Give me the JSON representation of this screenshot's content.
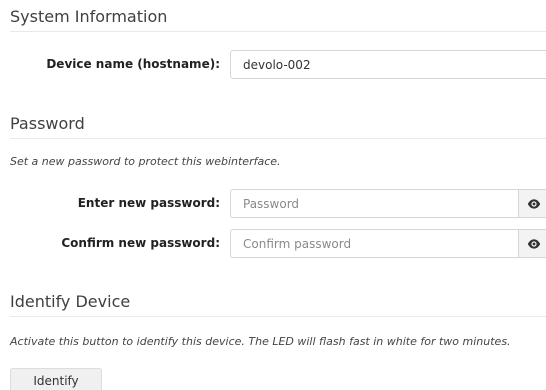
{
  "system": {
    "title": "System Information",
    "hostname_label": "Device name (hostname):",
    "hostname_value": "devolo-002"
  },
  "password": {
    "title": "Password",
    "description": "Set a new password to protect this webinterface.",
    "new_label": "Enter new password:",
    "new_placeholder": "Password",
    "confirm_label": "Confirm new password:",
    "confirm_placeholder": "Confirm password",
    "toggle_icon": "eye-icon"
  },
  "identify": {
    "title": "Identify Device",
    "description": "Activate this button to identify this device. The LED will flash fast in white for two minutes.",
    "button_label": "Identify"
  }
}
